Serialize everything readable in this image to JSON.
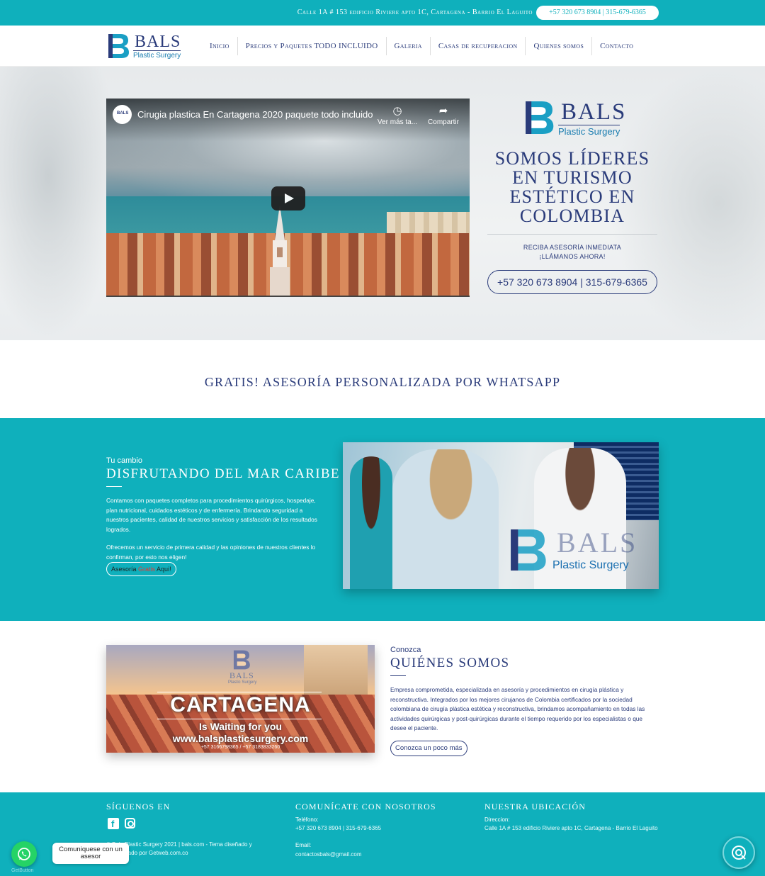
{
  "topbar": {
    "address": "Calle 1A # 153 edificio Riviere apto 1C, Cartagena - Barrio El Laguito",
    "phone": "+57 320 673 8904 | 315-679-6365"
  },
  "brand": {
    "name": "BALS",
    "tagline": "Plastic Surgery",
    "mark_letter": "B"
  },
  "nav": {
    "items": [
      {
        "label": "Inicio"
      },
      {
        "label": "Precios y Paquetes TODO INCLUIDO"
      },
      {
        "label": "Galeria"
      },
      {
        "label": "Casas de recuperacion"
      },
      {
        "label": "Quienes somos"
      },
      {
        "label": "Contacto"
      }
    ]
  },
  "hero": {
    "video": {
      "channel_badge": "BALS",
      "title": "Cirugia plastica En Cartagena 2020 paquete todo incluido",
      "watch_later": "Ver más ta...",
      "share": "Compartir"
    },
    "headline": "SOMOS LÍDERES EN TURISMO ESTÉTICO EN COLOMBIA",
    "cta_line1": "RECIBA ASESORÍA INMEDIATA",
    "cta_line2": "¡LLÁMANOS AHORA!",
    "phone_button": "+57 320 673 8904 | 315-679-6365"
  },
  "whatsapp_banner": {
    "heading": "GRATIS! ASESORÍA PERSONALIZADA POR WHATSAPP"
  },
  "caribe": {
    "eyebrow": "Tu cambio",
    "heading": "DISFRUTANDO DEL MAR CARIBE",
    "paragraph1": "Contamos con paquetes completos para procedimientos quirúrgicos, hospedaje, plan nutricional, cuidados estéticos y de enfermería. Brindando seguridad a nuestros pacientes, calidad de nuestros servicios y satisfacción de los resultados logrados.",
    "paragraph2": "Ofrecemos un servicio de primera calidad y las opiniones de nuestros clientes lo confirman, por esto nos eligen!",
    "button_prefix": "Asesoría ",
    "button_highlight": "Gratis",
    "button_suffix": " Aqui!",
    "photo_watermark_name": "BALS",
    "photo_watermark_sub": "Plastic Surgery"
  },
  "about": {
    "image": {
      "logo_name": "BALS",
      "logo_sub": "Plastic Surgery",
      "title": "CARTAGENA",
      "subtitle": "Is Waiting for you",
      "website": "www.balsplasticsurgery.com",
      "phones": "+57 3166798365 / +57 3183833260"
    },
    "eyebrow": "Conozca",
    "heading": "QUIÉNES SOMOS",
    "paragraph": "Empresa comprometida, especializada en asesoría y procedimientos en cirugía plástica y reconstructiva. Integrados por los mejores cirujanos de Colombia certificados por la sociedad colombiana de cirugía plástica estética y reconstructiva, brindamos acompañamiento en todas las actividades quirúrgicas y post-quirúrgicas durante el tiempo requerido por los especialistas o que desee el paciente.",
    "button": "Conozca un poco más"
  },
  "footer": {
    "social": {
      "heading": "SÍGUENOS EN",
      "facebook_glyph": "f",
      "copyright": "© Bals Plastic Surgery 2021 | bals.com - Tema diseñado y desarrollado por Getweb.com.co"
    },
    "contact": {
      "heading": "COMUNÍCATE CON NOSOTROS",
      "phone_label": "Teléfono:",
      "phone_value": "+57 320 673 8904 | 315-679-6365",
      "email_label": "Email:",
      "email_value": "contactosbals@gmail.com"
    },
    "location": {
      "heading": "NUESTRA UBICACIÓN",
      "address_label": "Direccion:",
      "address_value": "Calle 1A # 153 edificio Riviere apto 1C, Cartagena - Barrio El Laguito"
    }
  },
  "floating": {
    "whatsapp_tooltip": "Comuniquese con un asesor",
    "getbutton": "GetButton"
  },
  "colors": {
    "teal": "#0fb0bc",
    "navy": "#2a3b7a",
    "whatsapp": "#25d366",
    "highlight_red": "#e53935"
  }
}
